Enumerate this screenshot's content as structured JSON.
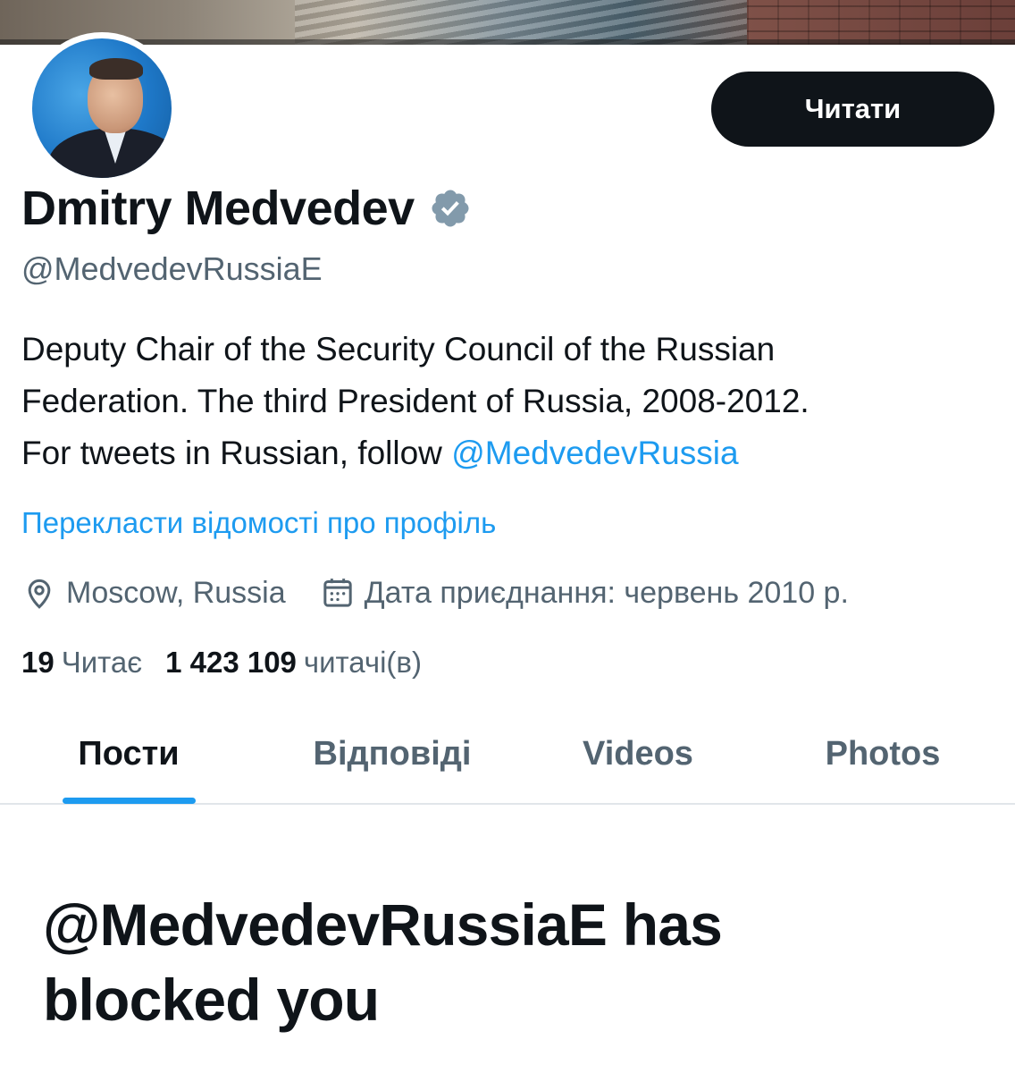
{
  "profile": {
    "display_name": "Dmitry Medvedev",
    "handle": "@MedvedevRussiaE",
    "bio_line1": "Deputy Chair of the Security Council of the Russian",
    "bio_line2": "Federation. The third President of Russia, 2008-2012.",
    "bio_line3_prefix": "For tweets in Russian, follow ",
    "bio_mention": "@MedvedevRussia",
    "translate_link": "Перекласти відомості про профіль",
    "location": "Moscow, Russia",
    "joined": "Дата приєднання: червень 2010 р.",
    "following_count": "19",
    "following_label": "Читає",
    "followers_count": "1 423 109",
    "followers_label": "читачі(в)",
    "follow_button_label": "Читати"
  },
  "icons": {
    "verified": "verified-badge-icon",
    "location": "location-pin-icon",
    "calendar": "calendar-icon"
  },
  "tabs": [
    {
      "label": "Пости",
      "active": true
    },
    {
      "label": "Відповіді",
      "active": false
    },
    {
      "label": "Videos",
      "active": false
    },
    {
      "label": "Photos",
      "active": false
    }
  ],
  "blocked_message": {
    "title_line1": "@MedvedevRussiaE has",
    "title_line2": "blocked you"
  },
  "colors": {
    "accent": "#1d9bf0",
    "text_primary": "#0f1419",
    "text_secondary": "#536471",
    "button_bg": "#0f1419",
    "verified_badge": "#829aab"
  }
}
